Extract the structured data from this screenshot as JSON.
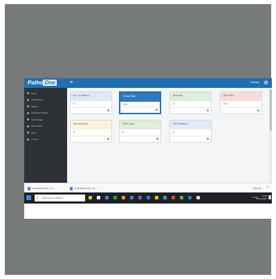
{
  "app": {
    "logo_text": "Patho",
    "logo_badge": "One"
  },
  "topbar": {
    "menu_icon": "hamburger-icon",
    "user": "Incharge",
    "settings_icon": "gear-icon"
  },
  "sidebar": {
    "items": [
      {
        "label": "Home",
        "icon": "home-icon"
      },
      {
        "label": "Transactions",
        "icon": "list-icon"
      },
      {
        "label": "Masters",
        "icon": "database-icon"
      },
      {
        "label": "Collection Reports",
        "icon": "report-icon"
      },
      {
        "label": "Test Listings",
        "icon": "flask-icon"
      },
      {
        "label": "Page Setup",
        "icon": "page-icon"
      },
      {
        "label": "Tools",
        "icon": "wrench-icon"
      },
      {
        "label": "Log out",
        "icon": "logout-icon"
      }
    ]
  },
  "cards": [
    {
      "title": "No. of Patients",
      "value": "0",
      "color": "#dce9f6"
    },
    {
      "title": "Gross Paid",
      "value": "908",
      "color": "#3278bf",
      "selected": true
    },
    {
      "title": "Discount",
      "value": "0",
      "color": "#dcefd8"
    },
    {
      "title": "Due Paid",
      "value": "500",
      "color": "#f7dcdc"
    },
    {
      "title": "Received Due",
      "value": "0",
      "color": "#fbf3d9"
    },
    {
      "title": "OPD Cash",
      "value": "0",
      "color": "#dcefd8"
    },
    {
      "title": "OPD Balance",
      "value": "0",
      "color": "#dfecf8"
    }
  ],
  "downloads": {
    "items": [
      {
        "name": "Credit Report (2b)...xls"
      },
      {
        "name": "Credit Report (2b)...xls"
      }
    ],
    "show_all": "Show all",
    "close_icon": "close-icon"
  },
  "taskbar": {
    "search_placeholder": "Type here to search",
    "tray_text": "^ ENG",
    "time": "12:08",
    "date": "09-11-2022",
    "icon_colors": [
      "#f0c23a",
      "#ffffff",
      "#3a8ee6",
      "#2f9e44",
      "#e0a030",
      "#4a86c8",
      "#8855cc",
      "#2a7de1",
      "#e8c030",
      "#3a9bd9",
      "#d94f4f",
      "#6ab04c",
      "#2b78c5",
      "#e0e0e0"
    ]
  }
}
